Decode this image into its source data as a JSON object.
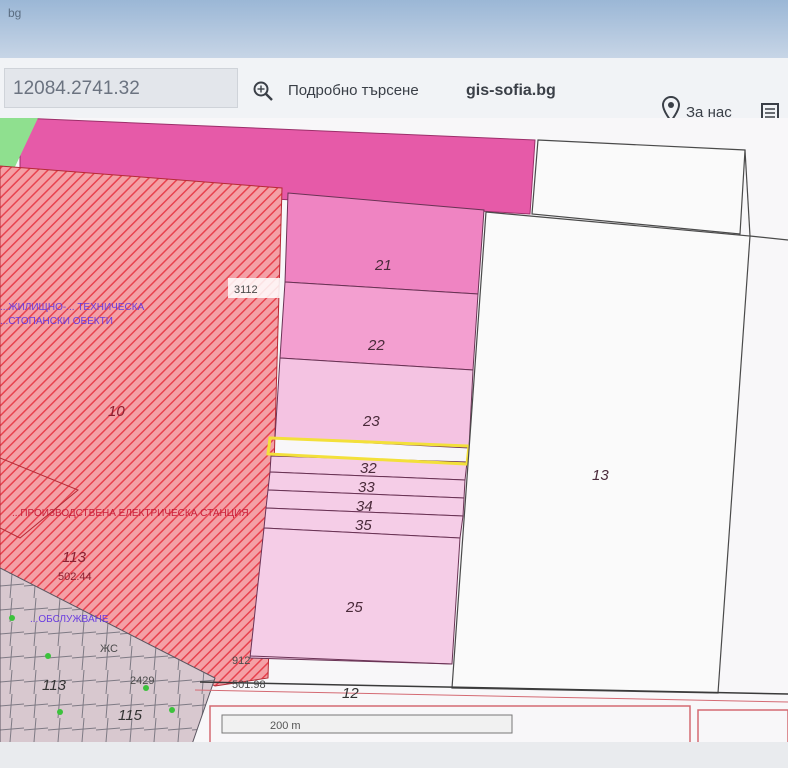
{
  "browser": {
    "tab_text": "bg"
  },
  "header": {
    "search_value": "12084.2741.32",
    "detailed_search_label": "Подробно търсене",
    "brand": "gis-sofia.bg",
    "about_label": "За нас"
  },
  "map": {
    "parcels": [
      {
        "id": "21",
        "label": "21"
      },
      {
        "id": "22",
        "label": "22"
      },
      {
        "id": "23",
        "label": "23"
      },
      {
        "id": "32",
        "label": "32"
      },
      {
        "id": "33",
        "label": "33"
      },
      {
        "id": "34",
        "label": "34"
      },
      {
        "id": "35",
        "label": "35"
      },
      {
        "id": "25",
        "label": "25"
      },
      {
        "id": "13",
        "label": "13"
      },
      {
        "id": "10",
        "label": "10"
      },
      {
        "id": "113a",
        "label": "113"
      },
      {
        "id": "113b",
        "label": "113"
      },
      {
        "id": "115",
        "label": "115"
      },
      {
        "id": "12",
        "label": "12"
      }
    ],
    "zone_labels": [
      "...ЖИЛИЩНО-... ТЕХНИЧЕСКА",
      "...СТОПАНСКИ ОБЕКТИ",
      "...ПРОИЗВОДСТВЕНА ЕЛЕКТРИЧЕСКА СТАНЦИЯ",
      "...ОБСЛУЖВАНЕ"
    ],
    "small_labels": [
      "2429",
      "ЖС",
      "502.44",
      "501.98",
      "3112",
      "912"
    ],
    "scale_label": "200 m",
    "highlight_color": "#f3e03a",
    "colors": {
      "pink_strong": "#e65aa8",
      "pink_mid": "#ef93cc",
      "pink_light": "#f3c2e0",
      "red_hatch": "#ef5a64",
      "green": "#8fe08f"
    }
  }
}
